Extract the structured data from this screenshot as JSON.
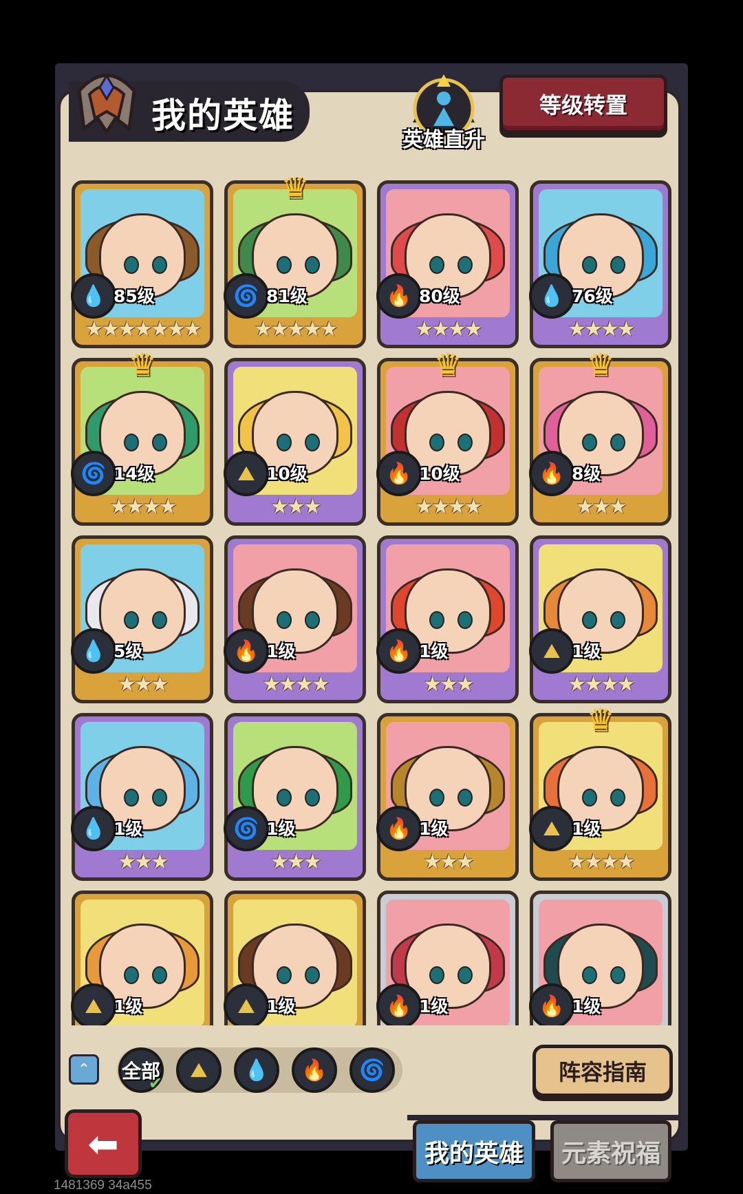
{
  "header": {
    "title": "我的英雄",
    "direct_up_label": "英雄直升",
    "level_transfer_label": "等级转置"
  },
  "heroes": [
    {
      "level": "85级",
      "element": "water",
      "stars": "★★★★★★★",
      "frame": "gold",
      "crown": false,
      "hair": "#8a5a2a"
    },
    {
      "level": "81级",
      "element": "wind",
      "stars": "★★★★★",
      "frame": "gold",
      "crown": true,
      "hair": "#3f8a4a"
    },
    {
      "level": "80级",
      "element": "fire",
      "stars": "★★★★",
      "frame": "purple",
      "crown": false,
      "hair": "#e04a4a"
    },
    {
      "level": "76级",
      "element": "water",
      "stars": "★★★★",
      "frame": "purple",
      "crown": false,
      "hair": "#3aa7d8"
    },
    {
      "level": "14级",
      "element": "wind",
      "stars": "★★★★",
      "frame": "gold",
      "crown": true,
      "hair": "#2f9a6a"
    },
    {
      "level": "10级",
      "element": "earth",
      "stars": "★★★",
      "frame": "purple",
      "crown": false,
      "hair": "#f1c447"
    },
    {
      "level": "10级",
      "element": "fire",
      "stars": "★★★★",
      "frame": "gold",
      "crown": true,
      "hair": "#c23030"
    },
    {
      "level": "8级",
      "element": "fire",
      "stars": "★★★",
      "frame": "gold",
      "crown": true,
      "hair": "#e0609a"
    },
    {
      "level": "5级",
      "element": "water",
      "stars": "★★★",
      "frame": "gold",
      "crown": false,
      "hair": "#e8e8ee"
    },
    {
      "level": "1级",
      "element": "fire",
      "stars": "★★★★",
      "frame": "purple",
      "crown": false,
      "hair": "#6a3a22"
    },
    {
      "level": "1级",
      "element": "fire",
      "stars": "★★★",
      "frame": "purple",
      "crown": false,
      "hair": "#e0452e"
    },
    {
      "level": "1级",
      "element": "earth",
      "stars": "★★★★",
      "frame": "purple",
      "crown": false,
      "hair": "#e8893a"
    },
    {
      "level": "1级",
      "element": "water",
      "stars": "★★★",
      "frame": "purple",
      "crown": false,
      "hair": "#5db3e6"
    },
    {
      "level": "1级",
      "element": "wind",
      "stars": "★★★",
      "frame": "purple",
      "crown": false,
      "hair": "#2f9a4a"
    },
    {
      "level": "1级",
      "element": "fire",
      "stars": "★★★",
      "frame": "gold",
      "crown": false,
      "hair": "#b8862a"
    },
    {
      "level": "1级",
      "element": "earth",
      "stars": "★★★★",
      "frame": "gold",
      "crown": true,
      "hair": "#e8703a"
    },
    {
      "level": "1级",
      "element": "earth",
      "stars": "",
      "frame": "gold",
      "crown": false,
      "hair": "#e89a3a"
    },
    {
      "level": "1级",
      "element": "earth",
      "stars": "",
      "frame": "gold",
      "crown": false,
      "hair": "#6a3a22"
    },
    {
      "level": "1级",
      "element": "fire",
      "stars": "",
      "frame": "silver",
      "crown": false,
      "hair": "#c23a4a"
    },
    {
      "level": "1级",
      "element": "fire",
      "stars": "",
      "frame": "silver",
      "crown": false,
      "hair": "#1e4a50"
    }
  ],
  "element_glyphs": {
    "water": "💧",
    "wind": "🌀",
    "fire": "🔥",
    "earth": "⛰"
  },
  "element_colors": {
    "water": "#4e9fe0",
    "wind": "#62b03a",
    "fire": "#e0505a",
    "earth": "#e8c24a"
  },
  "filters": {
    "all_label": "全部",
    "items": [
      "earth",
      "water",
      "fire",
      "wind"
    ]
  },
  "guide_button": "阵容指南",
  "tabs": {
    "my_heroes": "我的英雄",
    "element_blessing": "元素祝福"
  },
  "watermark": "1481369 34a455"
}
